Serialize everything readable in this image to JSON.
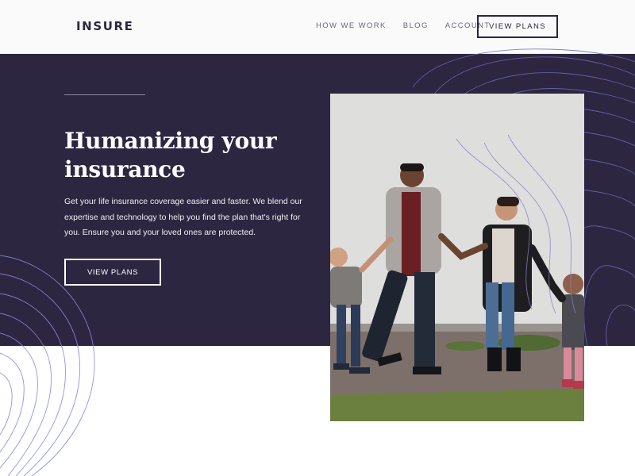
{
  "header": {
    "logo": "INSURE",
    "nav": [
      "HOW WE WORK",
      "BLOG",
      "ACCOUNT"
    ],
    "cta_label": "VIEW PLANS"
  },
  "hero": {
    "title_line1": "Humanizing your",
    "title_line2": "insurance",
    "description": "Get your life insurance coverage easier and faster. We blend our expertise and technology to help you find the plan that's right for you. Ensure you and your loved ones are protected.",
    "cta_label": "VIEW PLANS"
  },
  "colors": {
    "dark_violet": "#2c2640",
    "header_bg": "#fafafa",
    "pattern_stroke": "#7b76c7"
  }
}
